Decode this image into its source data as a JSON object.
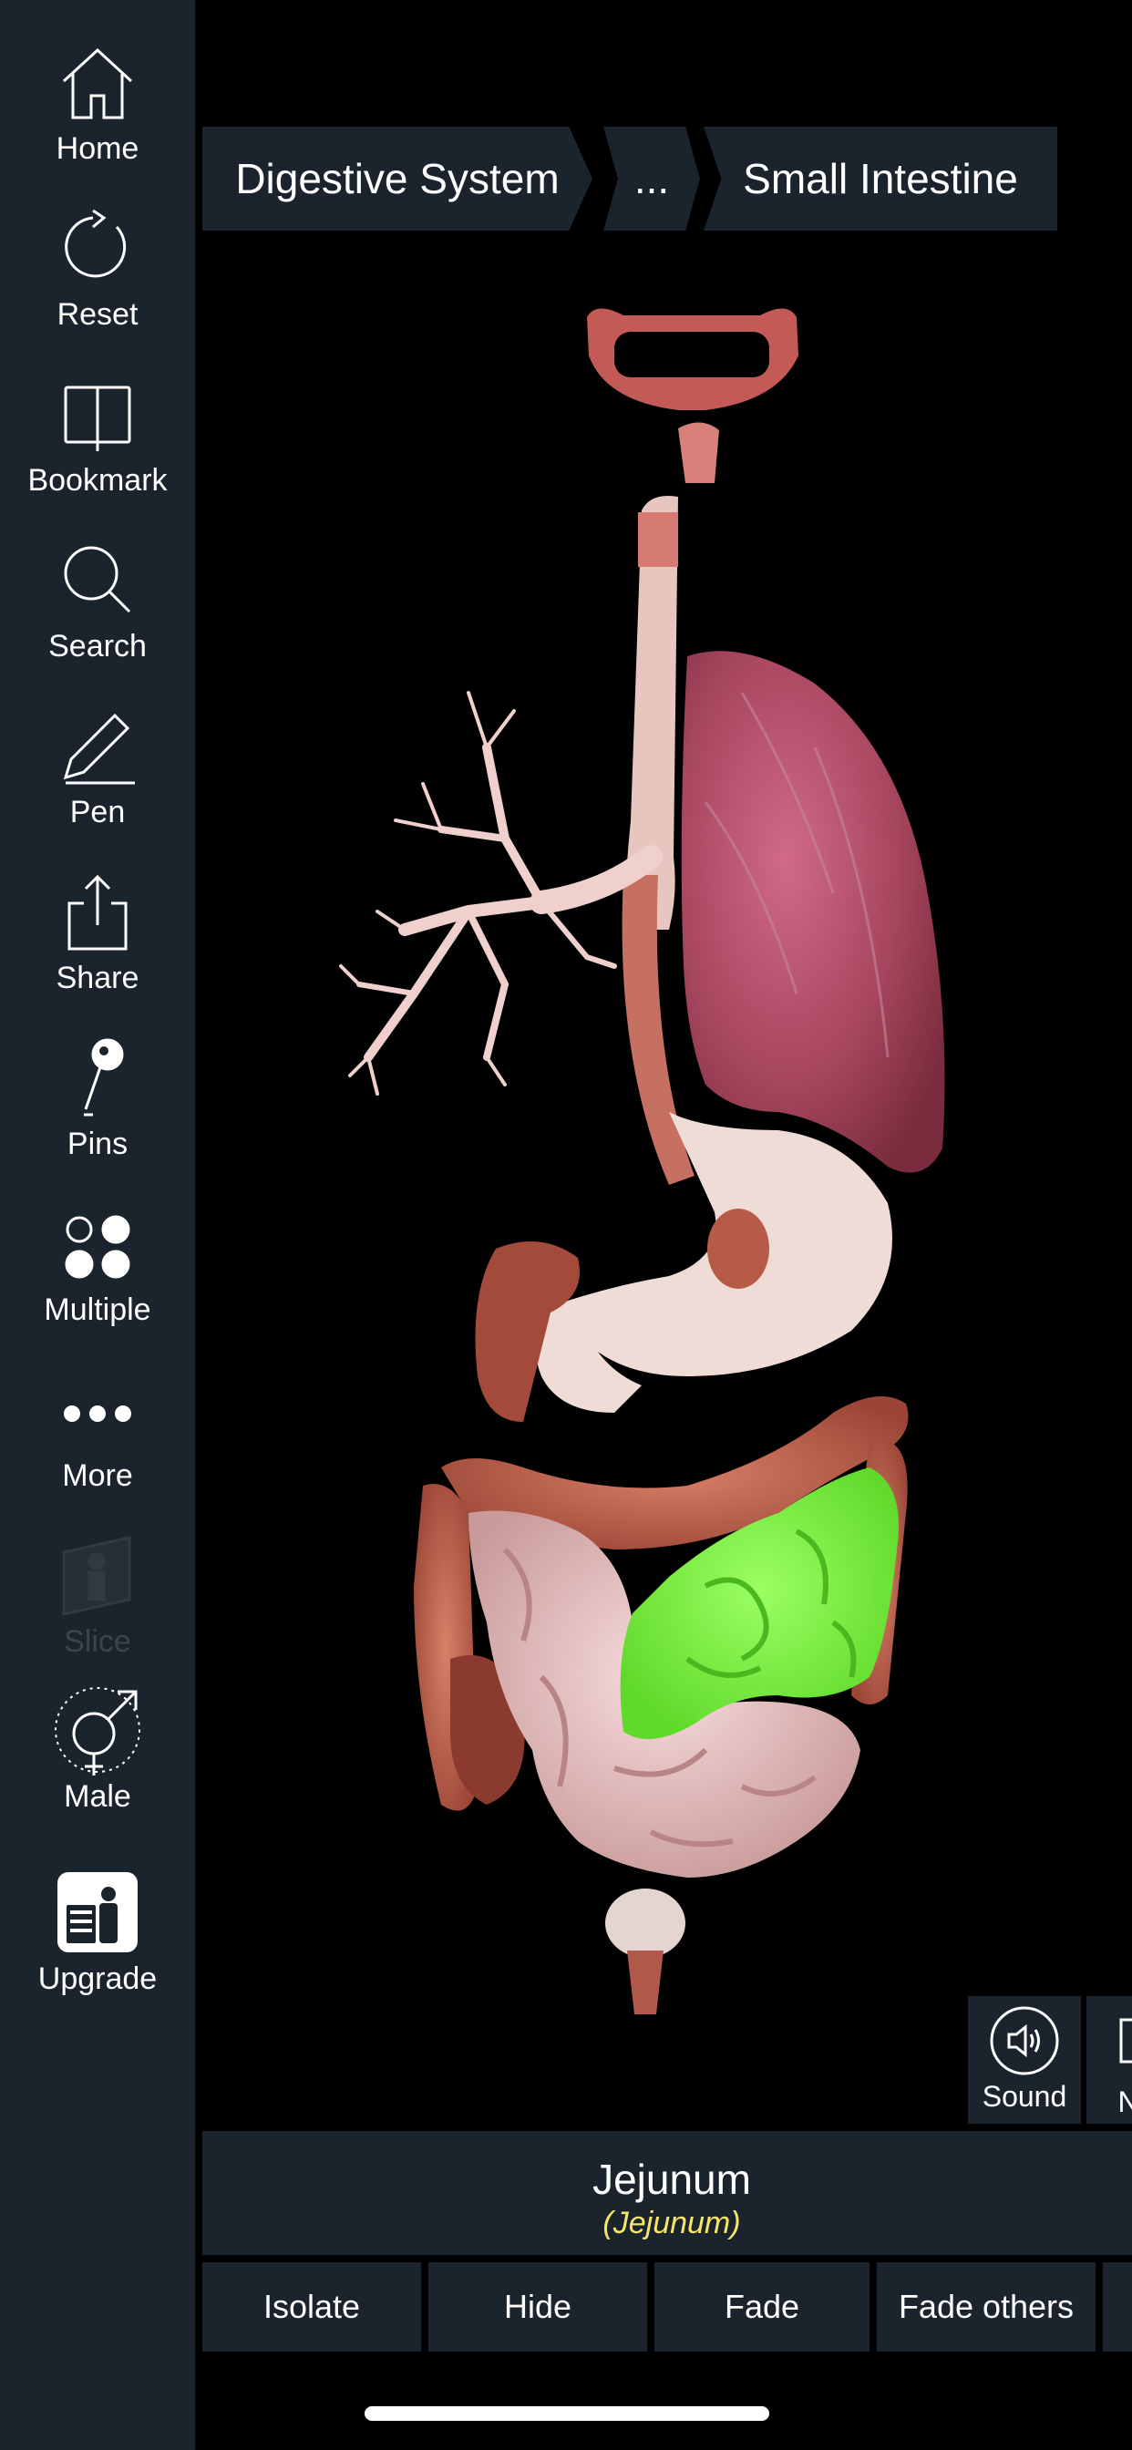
{
  "sidebar": {
    "items": [
      {
        "label": "Home",
        "icon": "home-icon"
      },
      {
        "label": "Reset",
        "icon": "reset-icon"
      },
      {
        "label": "Bookmark",
        "icon": "bookmark-icon"
      },
      {
        "label": "Search",
        "icon": "search-icon"
      },
      {
        "label": "Pen",
        "icon": "pen-icon"
      },
      {
        "label": "Share",
        "icon": "share-icon"
      },
      {
        "label": "Pins",
        "icon": "pin-icon"
      },
      {
        "label": "Multiple",
        "icon": "multiple-icon"
      },
      {
        "label": "More",
        "icon": "more-icon"
      },
      {
        "label": "Slice",
        "icon": "slice-icon",
        "disabled": true
      },
      {
        "label": "Male",
        "icon": "male-female-icon"
      },
      {
        "label": "Upgrade",
        "icon": "upgrade-icon"
      }
    ]
  },
  "breadcrumb": {
    "items": [
      "Digestive System",
      "...",
      "Small Intestine"
    ]
  },
  "tools": {
    "sound_label": "Sound",
    "next_label": "N"
  },
  "selection": {
    "name": "Jejunum",
    "latin": "(Jejunum)"
  },
  "actions": [
    "Isolate",
    "Hide",
    "Fade",
    "Fade others"
  ],
  "colors": {
    "panel": "#1b242c",
    "background": "#000000",
    "highlight": "#7dff3a",
    "latin_text": "#f5e66a"
  }
}
